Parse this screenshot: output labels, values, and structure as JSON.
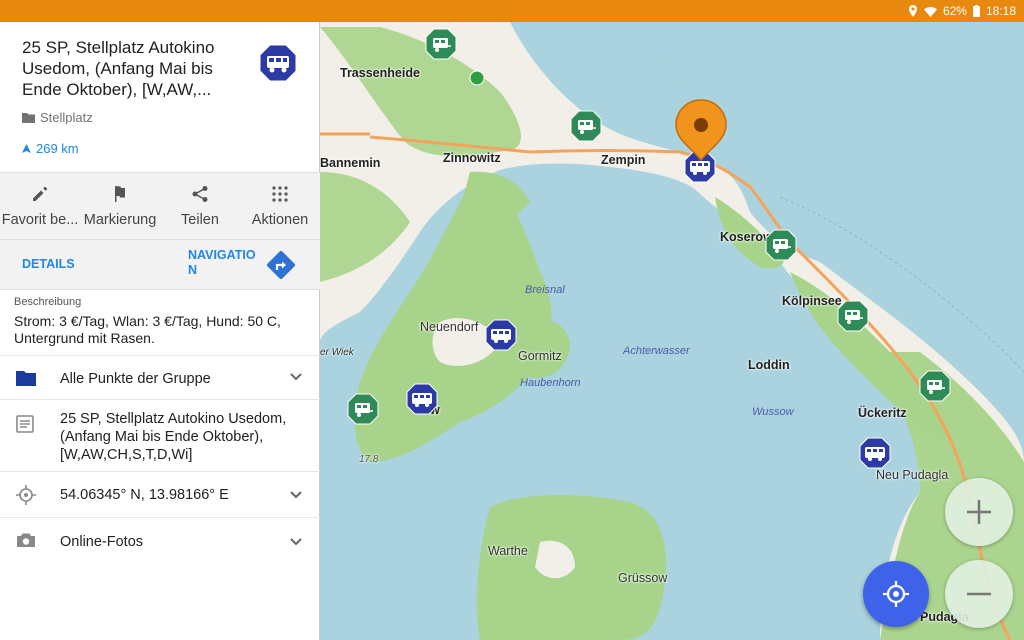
{
  "status": {
    "battery": "62%",
    "time": "18:18"
  },
  "poi": {
    "title": "25 SP, Stellplatz Autokino Usedom, (Anfang Mai bis Ende Oktober), [W,AW,...",
    "type": "Stellplatz",
    "distance": "269 km",
    "badge_icon": "camper-van-icon"
  },
  "actions": [
    {
      "label": "Favorit be...",
      "icon": "pencil-icon"
    },
    {
      "label": "Markierung",
      "icon": "flag-icon"
    },
    {
      "label": "Teilen",
      "icon": "share-icon"
    },
    {
      "label": "Aktionen",
      "icon": "grid-dots-icon"
    }
  ],
  "navrow": {
    "details": "DETAILS",
    "navigation": "NAVIGATION"
  },
  "description": {
    "heading": "Beschreibung",
    "text": "Strom: 3 €/Tag, Wlan: 3 €/Tag, Hund: 50 C, Untergrund mit Rasen."
  },
  "rows": {
    "group": "Alle Punkte der Gruppe",
    "name": "25 SP, Stellplatz Autokino Usedom, (Anfang Mai bis Ende Oktober), [W,AW,CH,S,T,D,Wi]",
    "coords": "54.06345° N, 13.98166° E",
    "photos": "Online-Fotos"
  },
  "map": {
    "labels": {
      "trassenheide": "Trassenheide",
      "bannemin": "Bannemin",
      "zinnowitz": "Zinnowitz",
      "zempin": "Zempin",
      "koserow": "Koserow",
      "koelpinsee": "Kölpinsee",
      "loddin": "Loddin",
      "ueckeritz": "Ückeritz",
      "neu_pudagla": "Neu Pudagla",
      "pudagla": "Pudagla",
      "neuendorf": "Neuendorf",
      "goermitz": "Gormitz",
      "lieper_winkel": "er Wiek",
      "warthe": "Warthe",
      "gruessow": "Grüssow",
      "breesnal": "Breisnal",
      "haubenhorn": "Haubenhorn",
      "achterwasser": "Achterwasser",
      "wussow": "Wussow",
      "rankwitz": "w",
      "height": "17.8"
    }
  },
  "colors": {
    "accent": "#e8890f",
    "link": "#1e88e5",
    "water": "#aad3df",
    "land": "#f2efe9",
    "forest": "#a7d38a",
    "camp_green": "#2e8b57",
    "camp_blue": "#2c3aa6",
    "locate_button": "#3f63e8"
  }
}
